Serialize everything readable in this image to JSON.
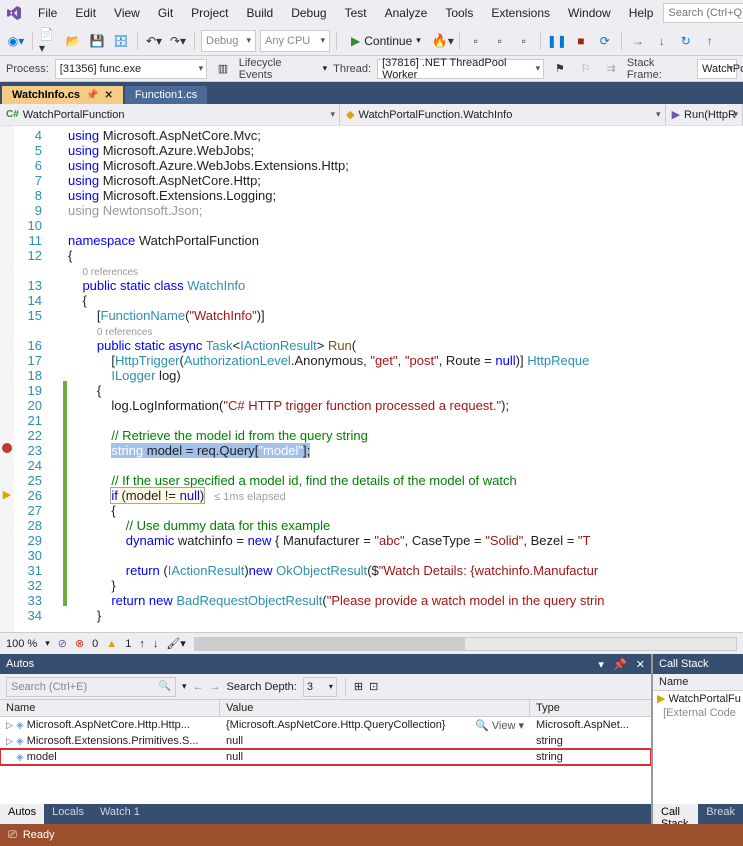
{
  "menu": {
    "items": [
      "File",
      "Edit",
      "View",
      "Git",
      "Project",
      "Build",
      "Debug",
      "Test",
      "Analyze",
      "Tools",
      "Extensions",
      "Window",
      "Help"
    ],
    "search_placeholder": "Search (Ctrl+Q)"
  },
  "toolbar": {
    "config": "Debug",
    "platform": "Any CPU",
    "continue_label": "Continue"
  },
  "debugbar": {
    "process_label": "Process:",
    "process_value": "[31356] func.exe",
    "lifecycle": "Lifecycle Events",
    "thread_label": "Thread:",
    "thread_value": "[37816] .NET ThreadPool Worker",
    "stackframe_label": "Stack Frame:",
    "stackframe_value": "WatchPo"
  },
  "tabs": {
    "active": "WatchInfo.cs",
    "other": "Function1.cs"
  },
  "nav": {
    "left": "WatchPortalFunction",
    "mid": "WatchPortalFunction.WatchInfo",
    "right": "Run(HttpR"
  },
  "code": {
    "lines": [
      {
        "n": 4,
        "html": "<span class='kw'>using</span> Microsoft.AspNetCore.Mvc;"
      },
      {
        "n": 5,
        "html": "<span class='kw'>using</span> Microsoft.Azure.WebJobs;"
      },
      {
        "n": 6,
        "html": "<span class='kw'>using</span> Microsoft.Azure.WebJobs.Extensions.Http;"
      },
      {
        "n": 7,
        "html": "<span class='kw'>using</span> Microsoft.AspNetCore.Http;"
      },
      {
        "n": 8,
        "html": "<span class='kw'>using</span> Microsoft.Extensions.Logging;"
      },
      {
        "n": 9,
        "html": "<span style='color:#999'>using</span> <span style='color:#999'>Newtonsoft.Json;</span>"
      },
      {
        "n": 10,
        "html": ""
      },
      {
        "n": 11,
        "html": "<span class='kw'>namespace</span> WatchPortalFunction"
      },
      {
        "n": 12,
        "html": "{"
      },
      {
        "n": 0,
        "html": "    <span class='ref'>0 references</span>"
      },
      {
        "n": 13,
        "html": "    <span class='kw'>public static class</span> <span class='type'>WatchInfo</span>"
      },
      {
        "n": 14,
        "html": "    {"
      },
      {
        "n": 15,
        "html": "        [<span class='type'>FunctionName</span>(<span class='str'>\"WatchInfo\"</span>)]"
      },
      {
        "n": 0,
        "html": "        <span class='ref'>0 references</span>"
      },
      {
        "n": 16,
        "html": "        <span class='kw'>public static async</span> <span class='type'>Task</span>&lt;<span class='type'>IActionResult</span>&gt; <span style='color:#74531f'>Run</span>("
      },
      {
        "n": 17,
        "html": "            [<span class='type'>HttpTrigger</span>(<span class='type'>AuthorizationLevel</span>.Anonymous, <span class='str'>\"get\"</span>, <span class='str'>\"post\"</span>, Route = <span class='kw'>null</span>)] <span class='type'>HttpReque</span>"
      },
      {
        "n": 18,
        "html": "            <span class='type'>ILogger</span> log)"
      },
      {
        "n": 19,
        "html": "        {",
        "bar": true
      },
      {
        "n": 20,
        "html": "            log.LogInformation(<span class='str'>\"C# HTTP trigger function processed a request.\"</span>);",
        "bar": true
      },
      {
        "n": 21,
        "html": "",
        "bar": true
      },
      {
        "n": 22,
        "html": "            <span class='cm'>// Retrieve the model id from the query string</span>",
        "bar": true
      },
      {
        "n": 23,
        "html": "            <span class='highlight-query'><span style='color:#fff'>string</span> model = req.Query[<span style='color:#fff'>\"model\"</span>];</span>",
        "bp": true,
        "bar": true
      },
      {
        "n": 24,
        "html": "",
        "bar": true
      },
      {
        "n": 25,
        "html": "            <span class='cm'>// If the user specified a model id, find the details of the model of watch</span>",
        "bar": true
      },
      {
        "n": 26,
        "html": "            <span class='currow curbox'><span class='kw'>if</span> (model != <span class='kw'>null</span>)</span><span class='elapsed'>≤ 1ms elapsed</span>",
        "cur": true,
        "bar": true
      },
      {
        "n": 27,
        "html": "            {",
        "bar": true
      },
      {
        "n": 28,
        "html": "                <span class='cm'>// Use dummy data for this example</span>",
        "bar": true
      },
      {
        "n": 29,
        "html": "                <span class='kw'>dynamic</span> watchinfo = <span class='kw'>new</span> { Manufacturer = <span class='str'>\"abc\"</span>, CaseType = <span class='str'>\"Solid\"</span>, Bezel = <span class='str'>\"T</span>",
        "bar": true
      },
      {
        "n": 30,
        "html": "",
        "bar": true
      },
      {
        "n": 31,
        "html": "                <span class='kw'>return</span> (<span class='type'>IActionResult</span>)<span class='kw'>new</span> <span class='type'>OkObjectResult</span>($<span class='str'>\"Watch Details: {watchinfo.Manufactur</span>",
        "bar": true
      },
      {
        "n": 32,
        "html": "            }",
        "bar": true
      },
      {
        "n": 33,
        "html": "            <span class='kw'>return new</span> <span class='type'>BadRequestObjectResult</span>(<span class='str'>\"Please provide a watch model in the query strin</span>",
        "bar": true
      },
      {
        "n": 34,
        "html": "        }"
      }
    ]
  },
  "statusline": {
    "zoom": "100 %",
    "errors": "0",
    "warnings": "1"
  },
  "autos": {
    "title": "Autos",
    "search_placeholder": "Search (Ctrl+E)",
    "depth_label": "Search Depth:",
    "depth_value": "3",
    "headers": {
      "name": "Name",
      "value": "Value",
      "type": "Type"
    },
    "rows": [
      {
        "name": "Microsoft.AspNetCore.Http.Http...",
        "value": "{Microsoft.AspNetCore.Http.QueryCollection}",
        "type": "Microsoft.AspNet...",
        "exp": "▷",
        "view": "🔍 View ▾"
      },
      {
        "name": "Microsoft.Extensions.Primitives.S...",
        "value": "null",
        "type": "string",
        "exp": "▷"
      },
      {
        "name": "model",
        "value": "null",
        "type": "string",
        "exp": "",
        "hi": true
      }
    ],
    "tabs": [
      "Autos",
      "Locals",
      "Watch 1"
    ]
  },
  "callstack": {
    "title": "Call Stack",
    "header": "Name",
    "rows": [
      {
        "icon": "▶",
        "text": "WatchPortalFu"
      },
      {
        "icon": "",
        "text": "[External Code"
      }
    ],
    "tabs": [
      "Call Stack",
      "Break"
    ]
  },
  "statusbar": {
    "text": "Ready"
  }
}
